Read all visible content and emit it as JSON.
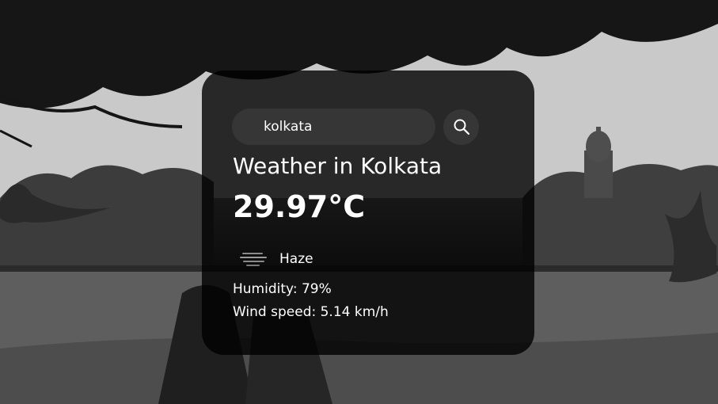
{
  "search": {
    "value": "kolkata",
    "placeholder": "",
    "icon": "search-icon"
  },
  "weather": {
    "title": "Weather in Kolkata",
    "temperature": "29.97°C",
    "icon": "haze-icon",
    "description": "Haze",
    "humidity": "Humidity: 79%",
    "wind": "Wind speed: 5.14 km/h"
  },
  "colors": {
    "card_background": "#000000",
    "text": "#ffffff",
    "input_background": "#7c7c7c"
  }
}
